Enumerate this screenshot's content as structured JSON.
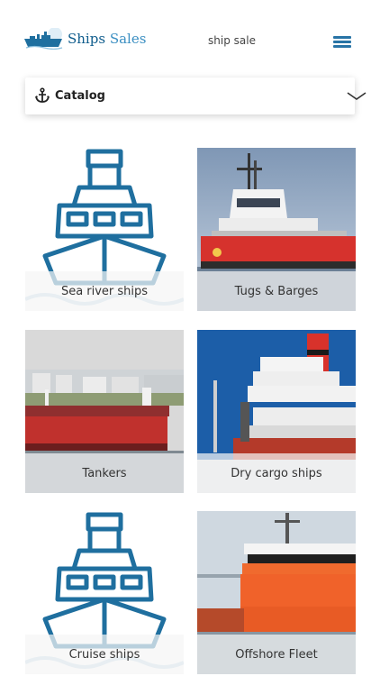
{
  "header": {
    "brand_part1": "Ships",
    "brand_part2": "Sales",
    "tagline": "ship sale",
    "icons": {
      "logo": "ship-logo-icon",
      "menu": "hamburger-menu-icon"
    }
  },
  "catalog": {
    "label": "Catalog",
    "icons": {
      "left": "anchor-icon",
      "right": "chevron-down-icon"
    }
  },
  "categories": [
    {
      "label": "Sea river ships",
      "image": "ship-outline-icon"
    },
    {
      "label": "Tugs & Barges",
      "image": "tug-photo"
    },
    {
      "label": "Tankers",
      "image": "tanker-photo"
    },
    {
      "label": "Dry cargo ships",
      "image": "cargo-ship-photo"
    },
    {
      "label": "Cruise ships",
      "image": "ship-outline-icon"
    },
    {
      "label": "Offshore Fleet",
      "image": "offshore-vessel-photo"
    }
  ],
  "colors": {
    "brand_blue": "#1f6f9f",
    "menu_blue": "#2874a6",
    "tug_red": "#d6322d",
    "offshore_orange": "#f0622a"
  }
}
